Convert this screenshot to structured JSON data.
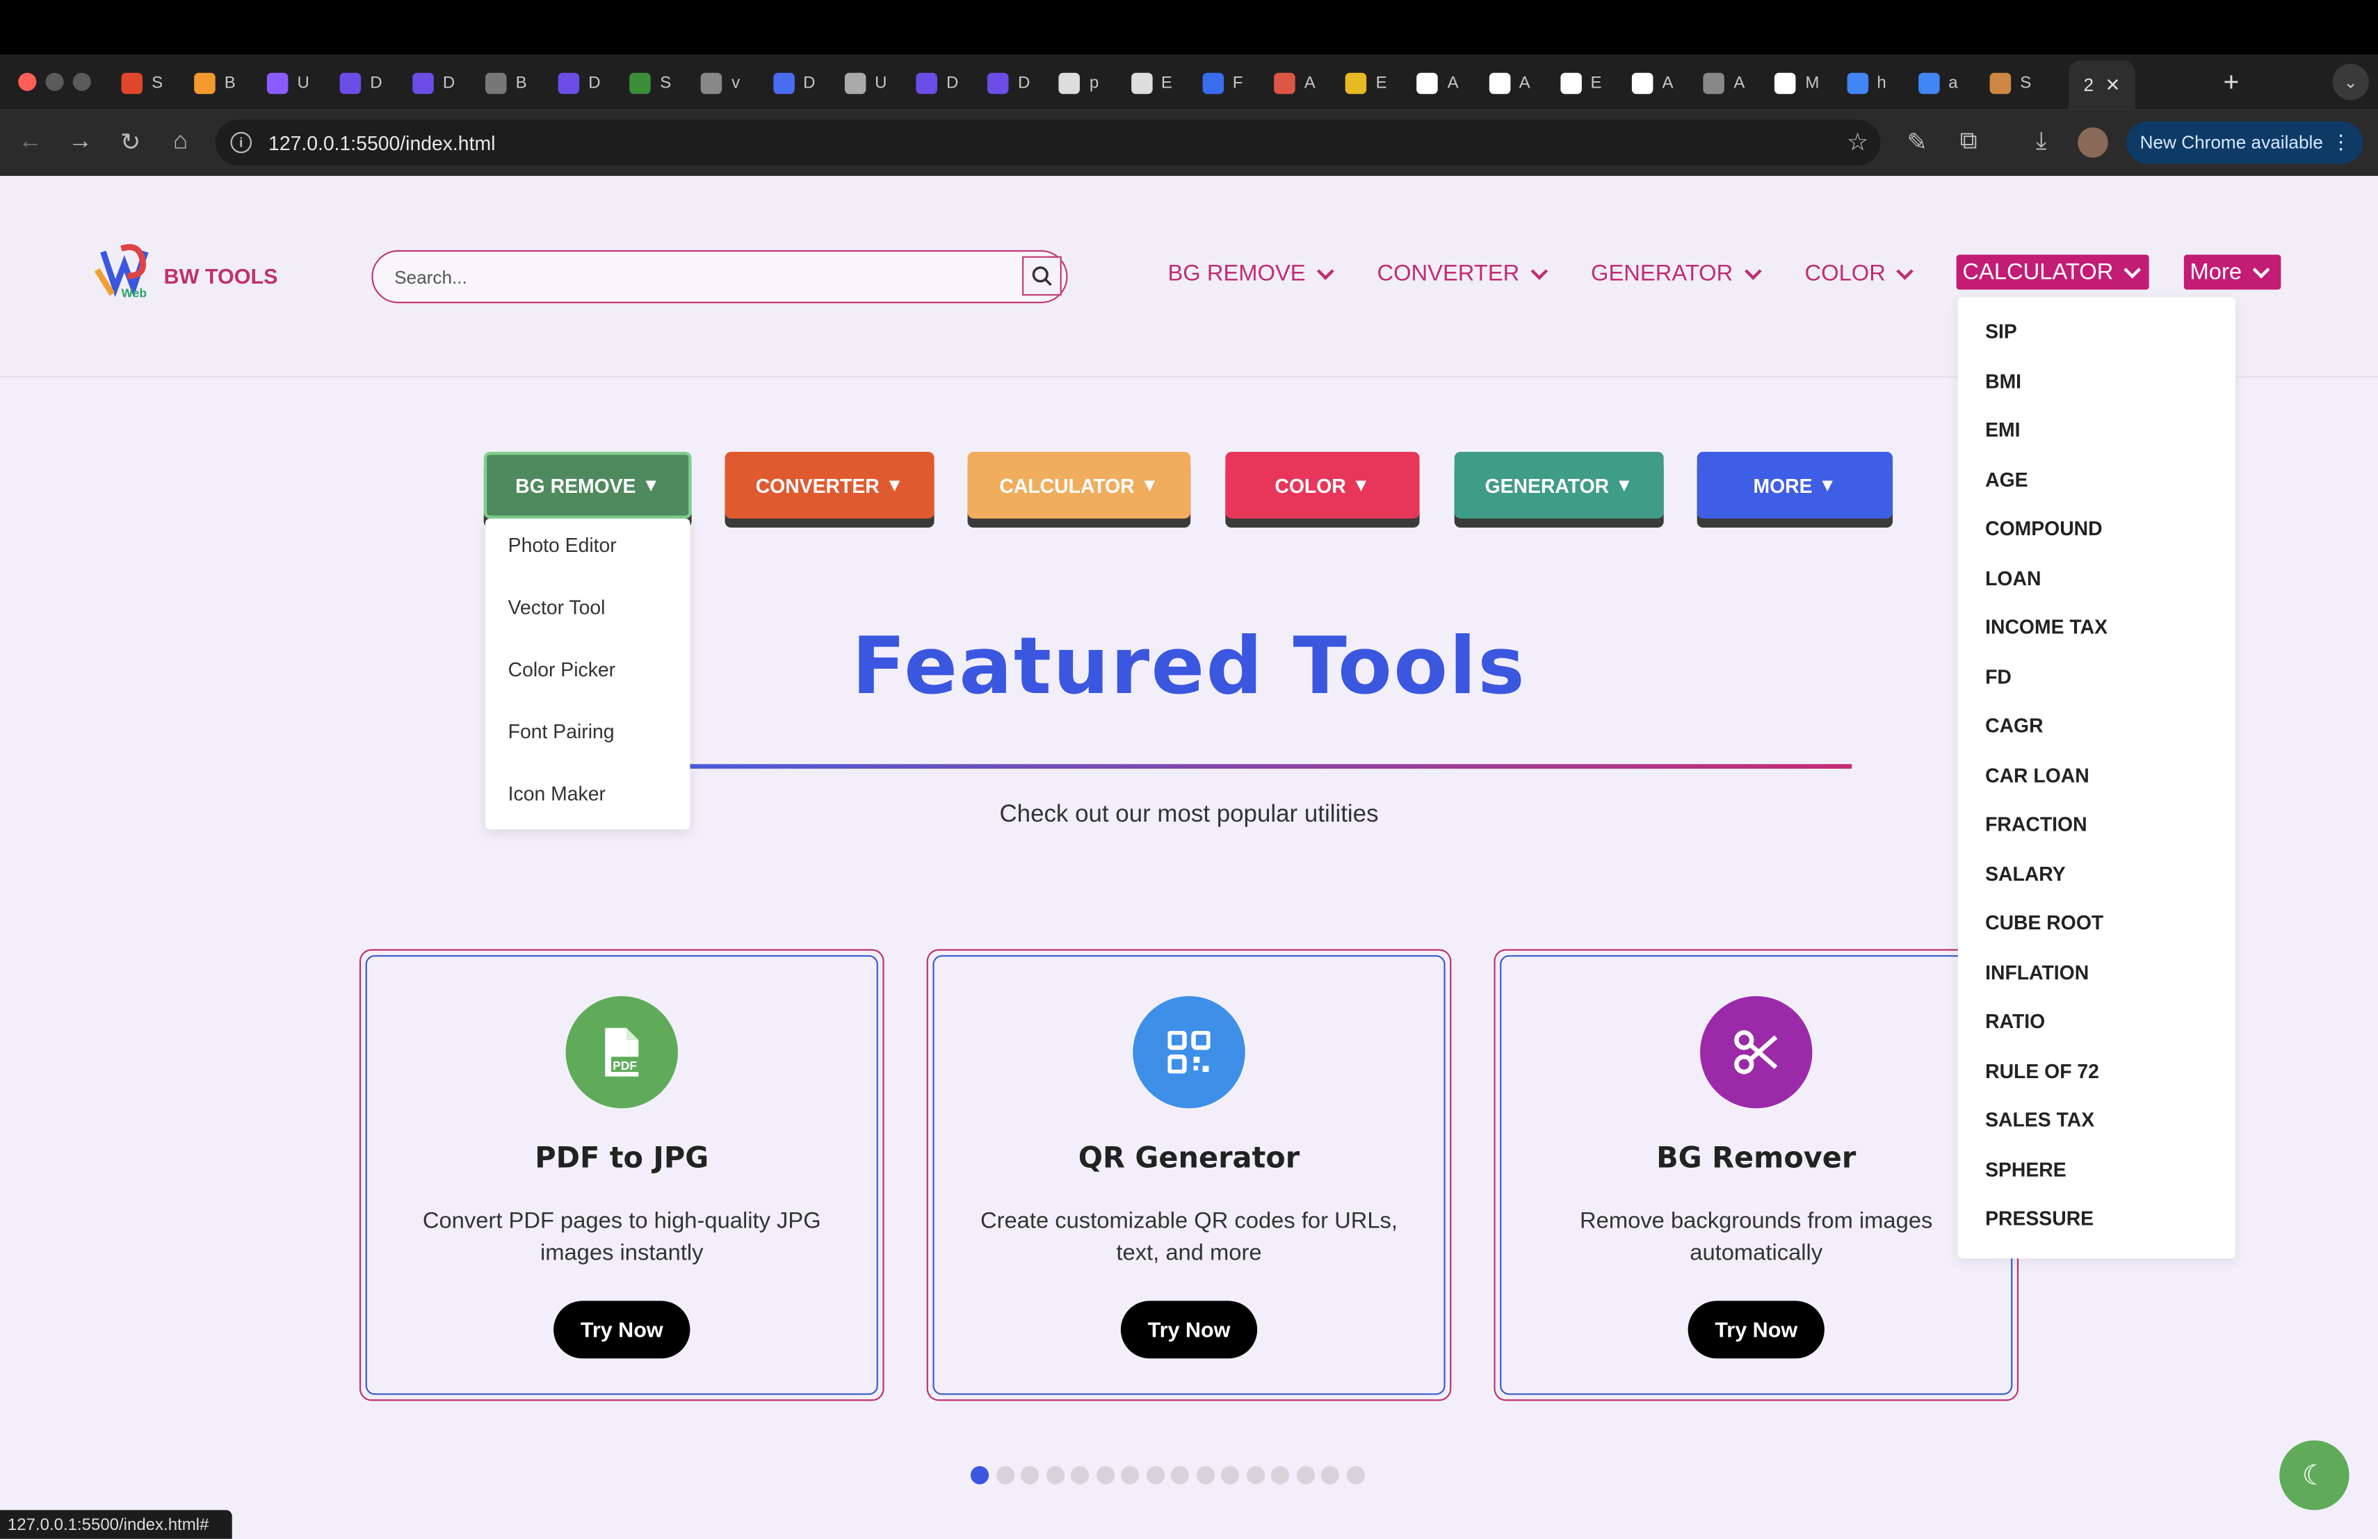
{
  "browser": {
    "url": "127.0.0.1:5500/index.html",
    "active_tab_label": "2",
    "new_chrome_label": "New Chrome available",
    "status_url": "127.0.0.1:5500/index.html#",
    "tabs": [
      "S",
      "B",
      "U",
      "D",
      "D",
      "B",
      "D",
      "S",
      "v",
      "D",
      "U",
      "D",
      "D",
      "p",
      "E",
      "F",
      "A",
      "E",
      "A",
      "A",
      "E",
      "A",
      "A",
      "M",
      "h",
      "a",
      "S"
    ]
  },
  "header": {
    "brand": "BW TOOLS",
    "search_placeholder": "Search...",
    "nav": [
      {
        "label": "BG REMOVE"
      },
      {
        "label": "CONVERTER"
      },
      {
        "label": "GENERATOR"
      },
      {
        "label": "COLOR"
      },
      {
        "label": "CALCULATOR"
      },
      {
        "label": "More"
      }
    ]
  },
  "calculator_menu": [
    "SIP",
    "BMI",
    "EMI",
    "AGE",
    "COMPOUND",
    "LOAN",
    "INCOME TAX",
    "FD",
    "CAGR",
    "CAR LOAN",
    "FRACTION",
    "SALARY",
    "CUBE ROOT",
    "INFLATION",
    "RATIO",
    "RULE OF 72",
    "SALES TAX",
    "SPHERE",
    "PRESSURE"
  ],
  "category_buttons": [
    {
      "label": "BG REMOVE",
      "color": "#4f8a5e"
    },
    {
      "label": "CONVERTER",
      "color": "#e05a2f"
    },
    {
      "label": "CALCULATOR",
      "color": "#f0ad5e"
    },
    {
      "label": "COLOR",
      "color": "#e8365b"
    },
    {
      "label": "GENERATOR",
      "color": "#3f9c86"
    },
    {
      "label": "MORE",
      "color": "#3f5ee6"
    }
  ],
  "bg_remove_menu": [
    "Photo Editor",
    "Vector Tool",
    "Color Picker",
    "Font Pairing",
    "Icon Maker"
  ],
  "featured": {
    "title": "Featured Tools",
    "subtitle": "Check out our most popular utilities"
  },
  "cards": [
    {
      "title": "PDF to JPG",
      "desc": "Convert PDF pages to high-quality JPG images instantly",
      "button": "Try Now",
      "icon": "pdf-file-icon",
      "color": "#5fab5a"
    },
    {
      "title": "QR Generator",
      "desc": "Create customizable QR codes for URLs, text, and more",
      "button": "Try Now",
      "icon": "qr-code-icon",
      "color": "#3d8fe8"
    },
    {
      "title": "BG Remover",
      "desc": "Remove backgrounds from images automatically",
      "button": "Try Now",
      "icon": "scissors-icon",
      "color": "#9b2aa8"
    }
  ],
  "carousel": {
    "count": 16,
    "active": 1
  }
}
